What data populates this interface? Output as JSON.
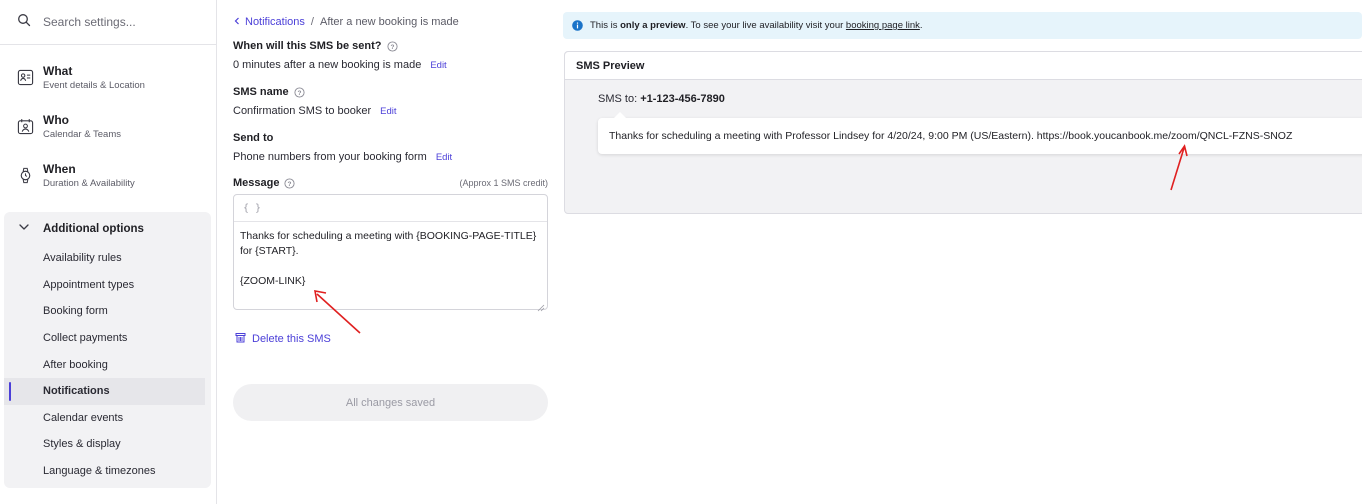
{
  "search": {
    "placeholder": "Search settings..."
  },
  "sidebar": {
    "main_items": [
      {
        "title": "What",
        "subtitle": "Event details & Location",
        "icon": "id-card-icon"
      },
      {
        "title": "Who",
        "subtitle": "Calendar & Teams",
        "icon": "calendar-person-icon"
      },
      {
        "title": "When",
        "subtitle": "Duration & Availability",
        "icon": "watch-icon"
      }
    ],
    "options_header": "Additional options",
    "options": [
      "Availability rules",
      "Appointment types",
      "Booking form",
      "Collect payments",
      "After booking",
      "Notifications",
      "Calendar events",
      "Styles & display",
      "Language & timezones"
    ],
    "active_option": "Notifications"
  },
  "form": {
    "breadcrumb": {
      "parent": "Notifications",
      "separator": "/",
      "current": "After a new booking is made"
    },
    "when_label": "When will this SMS be sent?",
    "when_value": "0 minutes after a new booking is made",
    "name_label": "SMS name",
    "name_value": "Confirmation SMS to booker",
    "send_label": "Send to",
    "send_value": "Phone numbers from your booking form",
    "edit_label": "Edit",
    "message_label": "Message",
    "credit_note": "(Approx 1 SMS credit)",
    "variable_button": "{ }",
    "message_text": "Thanks for scheduling a meeting with {BOOKING-PAGE-TITLE} for {START}.\n\n{ZOOM-LINK}",
    "delete_label": "Delete this SMS",
    "save_status": "All changes saved"
  },
  "notice": {
    "prefix": "This is ",
    "bold": "only a preview",
    "middle": ". To see your live availability visit your ",
    "link": "booking page link",
    "suffix": "."
  },
  "preview": {
    "title": "SMS Preview",
    "to_label": "SMS to:",
    "to_number": "+1-123-456-7890",
    "message": "Thanks for scheduling a meeting with Professor Lindsey for 4/20/24, 9:00 PM (US/Eastern). https://book.youcanbook.me/zoom/QNCL-FZNS-SNOZ"
  },
  "colors": {
    "accent": "#4b3fd8",
    "annotation": "#e02020",
    "notice_bg": "#e6f4fb",
    "info_icon": "#1a73c8"
  }
}
